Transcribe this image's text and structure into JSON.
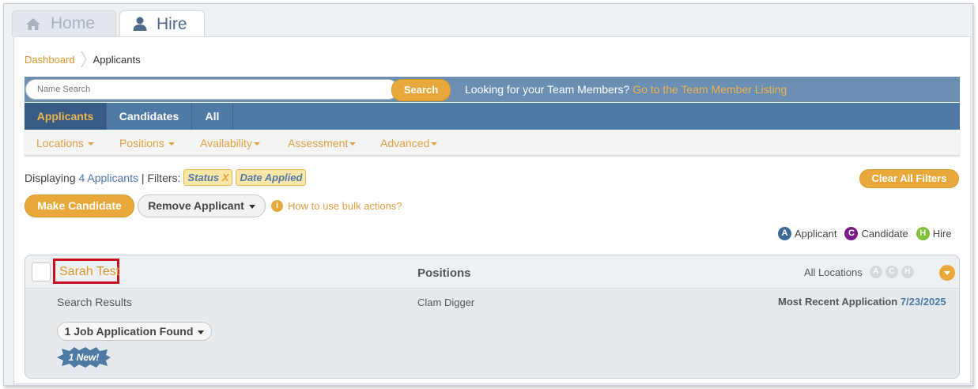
{
  "top_tabs": {
    "home": "Home",
    "hire": "Hire"
  },
  "breadcrumb": {
    "dashboard": "Dashboard",
    "current": "Applicants"
  },
  "search": {
    "placeholder": "Name Search",
    "button": "Search",
    "team_text": "Looking for your Team Members?",
    "team_link": "Go to the Team Member Listing"
  },
  "view_tabs": [
    {
      "label": "Applicants",
      "active": true
    },
    {
      "label": "Candidates",
      "active": false
    },
    {
      "label": "All",
      "active": false
    }
  ],
  "filter_menus": [
    "Locations",
    "Positions",
    "Availability",
    "Assessment",
    "Advanced"
  ],
  "display": {
    "prefix": "Displaying",
    "count_text": "4 Applicants",
    "filters_label": "| Filters:",
    "chips": [
      {
        "label": "Status",
        "removable": "X"
      },
      {
        "label": "Date Applied"
      }
    ],
    "clear_all": "Clear All Filters"
  },
  "bulk": {
    "make_candidate": "Make Candidate",
    "remove_applicant": "Remove Applicant",
    "help": "How to use bulk actions?"
  },
  "legend": [
    {
      "letter": "A",
      "label": "Applicant",
      "color": "#3e6a98"
    },
    {
      "letter": "C",
      "label": "Candidate",
      "color": "#7a1b86"
    },
    {
      "letter": "H",
      "label": "Hire",
      "color": "#7ec239"
    }
  ],
  "applicant": {
    "name": "Sarah Test",
    "positions_header": "Positions",
    "locations": "All Locations",
    "status_badges": [
      "A",
      "C",
      "H"
    ],
    "source": "Search Results",
    "position": "Clam Digger",
    "recent_label": "Most Recent Application",
    "recent_date": "7/23/2025",
    "jobs_found": "1 Job Application Found",
    "new_badge": "1 New!"
  },
  "colors": {
    "accent": "#e9a83a",
    "nav_blue": "#4f7aa6",
    "highlight_border": "#c8101f"
  }
}
